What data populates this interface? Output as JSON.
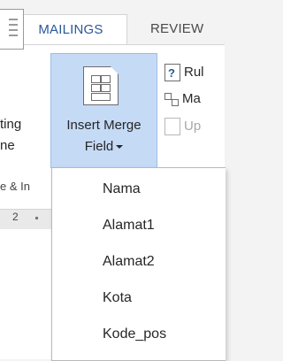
{
  "tabs": {
    "active": "MAILINGS",
    "next": "REVIEW"
  },
  "left_button": {
    "line1": "ting",
    "line2": "ne"
  },
  "insert_merge_field": {
    "line1": "Insert Merge",
    "line2": "Field"
  },
  "right_buttons": [
    {
      "label": "Rul",
      "icon": "rules-icon",
      "enabled": true
    },
    {
      "label": "Ma",
      "icon": "match-fields-icon",
      "enabled": true
    },
    {
      "label": "Up",
      "icon": "update-labels-icon",
      "enabled": false
    }
  ],
  "group_label": "e & In",
  "ruler": {
    "number": "2"
  },
  "menu": {
    "items": [
      "Nama",
      "Alamat1",
      "Alamat2",
      "Kota",
      "Kode_pos"
    ]
  },
  "colors": {
    "accent": "#2b579a",
    "pressed_bg": "#c5daf5"
  }
}
